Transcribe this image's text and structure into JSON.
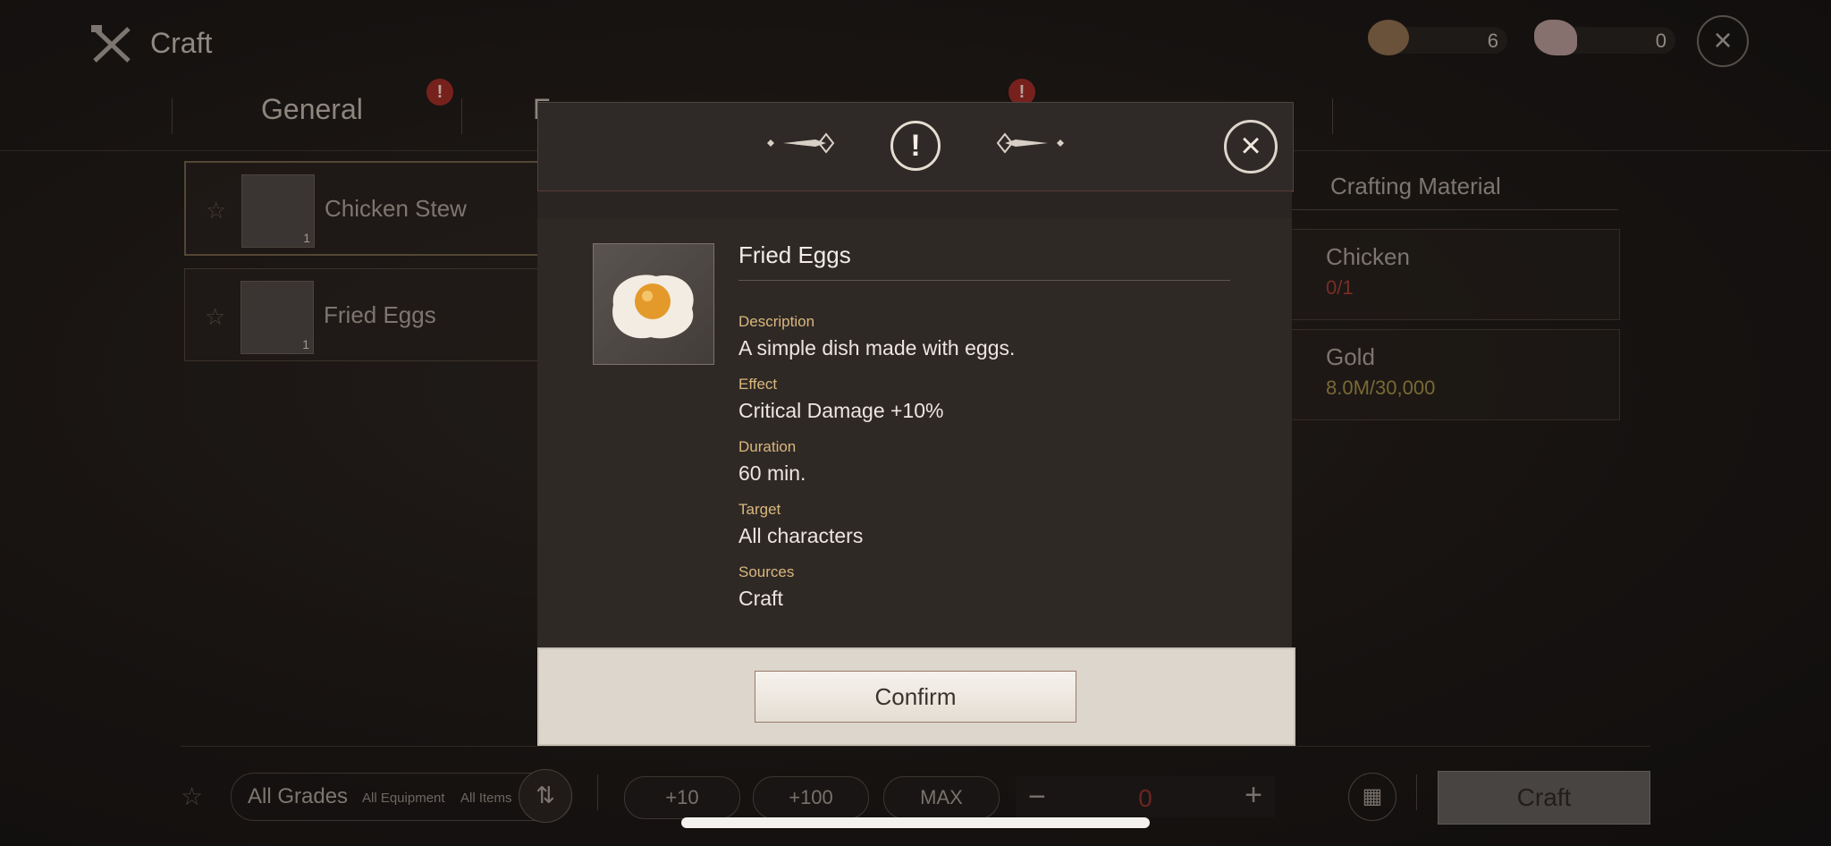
{
  "header": {
    "title": "Craft"
  },
  "currencies": [
    {
      "name": "stew-currency",
      "value": "6"
    },
    {
      "name": "chicken-currency",
      "value": "0"
    }
  ],
  "tabs": [
    {
      "label": "General"
    },
    {
      "label": "F"
    }
  ],
  "recipes": [
    {
      "name": "Chicken Stew",
      "count": "1"
    },
    {
      "name": "Fried Eggs",
      "count": "1"
    }
  ],
  "materials": {
    "header": "Crafting Material",
    "items": [
      {
        "name": "Chicken",
        "value": "0/1",
        "color": "#9b3b30"
      },
      {
        "name": "Gold",
        "value": "8.0M/30,000",
        "color": "#9c8a45"
      }
    ]
  },
  "filters": {
    "grade": "All Grades",
    "equipment": "All Equipment",
    "items": "All Items"
  },
  "quantity": {
    "plus10": "+10",
    "plus100": "+100",
    "max": "MAX",
    "minus": "−",
    "plus": "+",
    "value": "0"
  },
  "craft_button": "Craft",
  "modal": {
    "item_name": "Fried Eggs",
    "fields": [
      {
        "label": "Description",
        "value": "A simple dish made with eggs."
      },
      {
        "label": "Effect",
        "value": "Critical Damage +10%"
      },
      {
        "label": "Duration",
        "value": "60 min."
      },
      {
        "label": "Target",
        "value": "All characters"
      },
      {
        "label": "Sources",
        "value": "Craft"
      }
    ],
    "confirm_label": "Confirm"
  },
  "colors": {
    "accent_gold": "#d9b77c",
    "alert_red": "#9b2a25"
  }
}
